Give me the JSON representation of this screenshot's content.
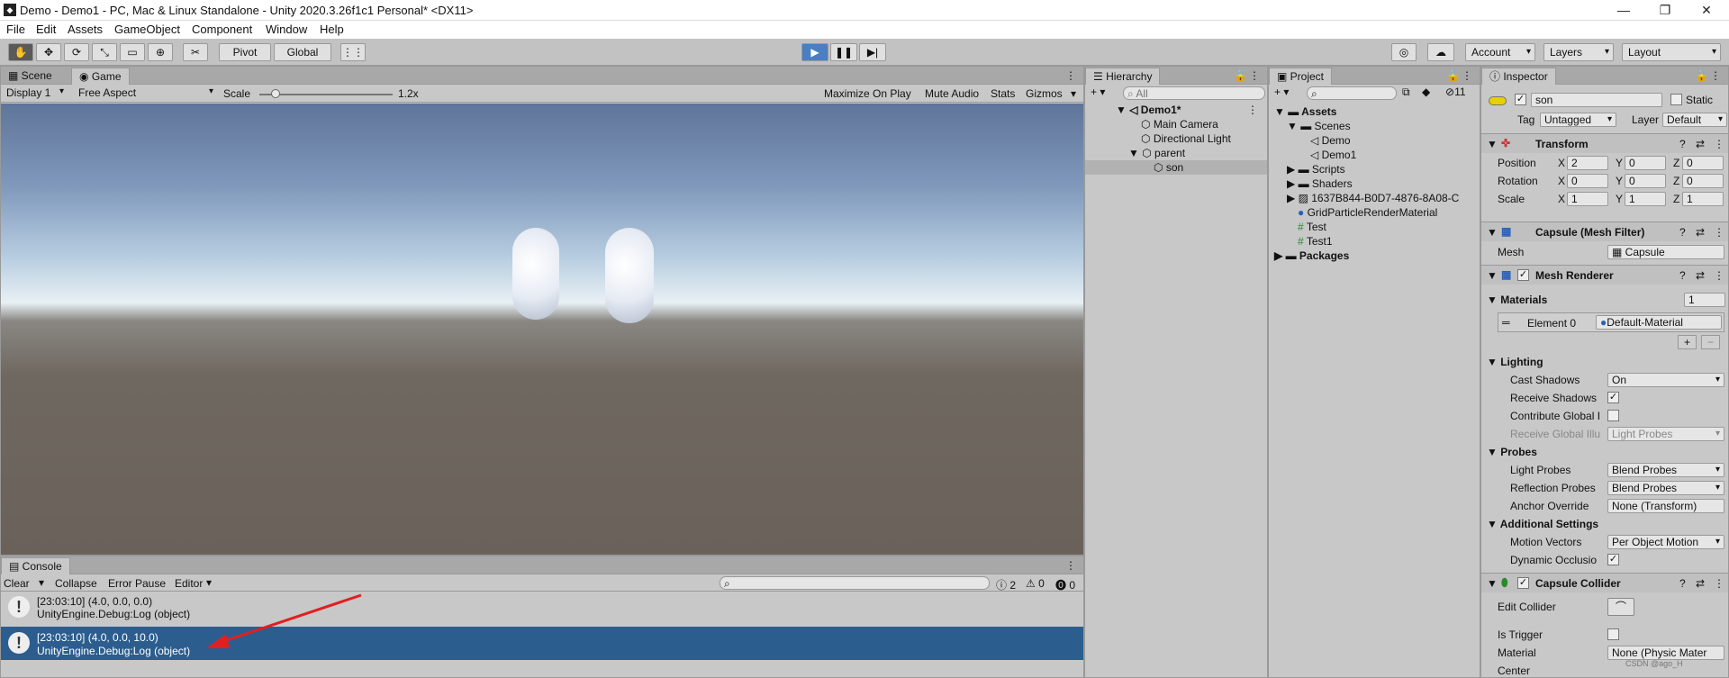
{
  "window": {
    "title": "Demo - Demo1 - PC, Mac & Linux Standalone - Unity 2020.3.26f1c1 Personal* <DX11>"
  },
  "menu": [
    "File",
    "Edit",
    "Assets",
    "GameObject",
    "Component",
    "Window",
    "Help"
  ],
  "toolbar": {
    "pivot": "Pivot",
    "global": "Global",
    "account": "Account",
    "layers": "Layers",
    "layout": "Layout"
  },
  "scene_tabs": {
    "scene": "Scene",
    "game": "Game"
  },
  "game_bar": {
    "display": "Display 1",
    "aspect": "Free Aspect",
    "scale_label": "Scale",
    "scale_value": "1.2x",
    "maximize": "Maximize On Play",
    "mute": "Mute Audio",
    "stats": "Stats",
    "gizmos": "Gizmos"
  },
  "console": {
    "tab": "Console",
    "clear": "Clear",
    "collapse": "Collapse",
    "error_pause": "Error Pause",
    "editor": "Editor",
    "count_log": "2",
    "count_warn": "0",
    "count_err": "0",
    "entries": [
      {
        "line1": "[23:03:10] (4.0, 0.0, 0.0)",
        "line2": "UnityEngine.Debug:Log (object)"
      },
      {
        "line1": "[23:03:10] (4.0, 0.0, 10.0)",
        "line2": "UnityEngine.Debug:Log (object)"
      }
    ]
  },
  "hierarchy": {
    "tab": "Hierarchy",
    "search": "All",
    "items": [
      "Demo1*",
      "Main Camera",
      "Directional Light",
      "parent",
      "son"
    ]
  },
  "project": {
    "tab": "Project",
    "hidden_count": "11",
    "items": [
      "Assets",
      "Scenes",
      "Demo",
      "Demo1",
      "Scripts",
      "Shaders",
      "1637B844-B0D7-4876-8A08-C",
      "GridParticleRenderMaterial",
      "Test",
      "Test1",
      "Packages"
    ]
  },
  "inspector": {
    "tab": "Inspector",
    "name": "son",
    "static": "Static",
    "tag_label": "Tag",
    "tag": "Untagged",
    "layer_label": "Layer",
    "layer": "Default",
    "transform": {
      "title": "Transform",
      "position": "Position",
      "rotation": "Rotation",
      "scale": "Scale",
      "pos": [
        "2",
        "0",
        "0"
      ],
      "rot": [
        "0",
        "0",
        "0"
      ],
      "scl": [
        "1",
        "1",
        "1"
      ],
      "x": "X",
      "y": "Y",
      "z": "Z"
    },
    "mesh_filter": {
      "title": "Capsule (Mesh Filter)",
      "mesh_label": "Mesh",
      "mesh": "Capsule"
    },
    "mesh_renderer": {
      "title": "Mesh Renderer",
      "materials": "Materials",
      "materials_count": "1",
      "element0": "Element 0",
      "material": "Default-Material",
      "lighting": "Lighting",
      "cast_shadows": "Cast Shadows",
      "cast_shadows_val": "On",
      "receive_shadows": "Receive Shadows",
      "contribute_gi": "Contribute Global I",
      "receive_gi": "Receive Global Illu",
      "receive_gi_val": "Light Probes",
      "probes": "Probes",
      "light_probes": "Light Probes",
      "light_probes_val": "Blend Probes",
      "reflection_probes": "Reflection Probes",
      "reflection_probes_val": "Blend Probes",
      "anchor": "Anchor Override",
      "anchor_val": "None (Transform)",
      "additional": "Additional Settings",
      "motion": "Motion Vectors",
      "motion_val": "Per Object Motion",
      "dynamic": "Dynamic Occlusio"
    },
    "collider": {
      "title": "Capsule Collider",
      "edit": "Edit Collider",
      "trigger": "Is Trigger",
      "material_label": "Material",
      "material": "None (Physic Mater",
      "center": "Center"
    }
  },
  "watermark": "CSDN @ago_H"
}
